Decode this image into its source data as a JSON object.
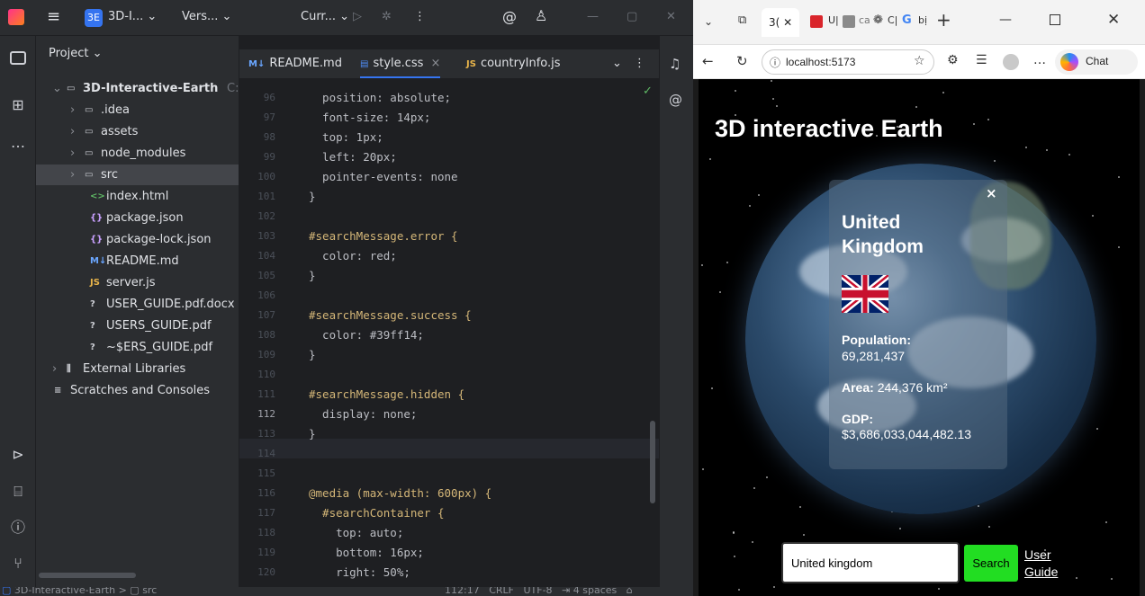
{
  "ide": {
    "toolbar": {
      "project_badge": "3E",
      "project_name": "3D-I...",
      "vcs": "Vers...",
      "run_config": "Curr..."
    },
    "project_panel": {
      "title": "Project",
      "tree": [
        {
          "label": "3D-Interactive-Earth",
          "suffix": "C:\\V",
          "indent": 0,
          "icon": "folder-icon",
          "arrow": "v"
        },
        {
          "label": ".idea",
          "indent": 1,
          "icon": "folder-icon",
          "arrow": ">"
        },
        {
          "label": "assets",
          "indent": 1,
          "icon": "folder-icon",
          "arrow": ">"
        },
        {
          "label": "node_modules",
          "indent": 1,
          "icon": "folder-icon",
          "arrow": ">"
        },
        {
          "label": "src",
          "indent": 1,
          "icon": "folder-icon",
          "arrow": ">",
          "selected": true
        },
        {
          "label": "index.html",
          "indent": 2,
          "icon": "html-icon"
        },
        {
          "label": "package.json",
          "indent": 2,
          "icon": "json-icon"
        },
        {
          "label": "package-lock.json",
          "indent": 2,
          "icon": "json-icon"
        },
        {
          "label": "README.md",
          "indent": 2,
          "icon": "markdown-icon"
        },
        {
          "label": "server.js",
          "indent": 2,
          "icon": "js-icon"
        },
        {
          "label": "USER_GUIDE.pdf.docx",
          "indent": 2,
          "icon": "unknown-file-icon"
        },
        {
          "label": "USERS_GUIDE.pdf",
          "indent": 2,
          "icon": "unknown-file-icon"
        },
        {
          "label": "~$ERS_GUIDE.pdf",
          "indent": 2,
          "icon": "unknown-file-icon"
        },
        {
          "label": "External Libraries",
          "indent": 0,
          "icon": "library-icon",
          "arrow": ">"
        },
        {
          "label": "Scratches and Consoles",
          "indent": 0,
          "icon": "scratches-icon"
        }
      ]
    },
    "tabs": [
      {
        "label": "README.md",
        "icon": "markdown-icon"
      },
      {
        "label": "style.css",
        "icon": "css-icon",
        "active": true,
        "close": "×"
      },
      {
        "label": "countryInfo.js",
        "icon": "js-icon"
      }
    ],
    "code": [
      {
        "n": "96",
        "text": "  position: absolute;"
      },
      {
        "n": "97",
        "text": "  font-size: 14px;"
      },
      {
        "n": "98",
        "text": "  top: 1px;"
      },
      {
        "n": "99",
        "text": "  left: 20px;"
      },
      {
        "n": "100",
        "text": "  pointer-events: none"
      },
      {
        "n": "101",
        "text": "}"
      },
      {
        "n": "102",
        "text": ""
      },
      {
        "n": "103",
        "text": "#searchMessage.error {"
      },
      {
        "n": "104",
        "text": "  color: red;"
      },
      {
        "n": "105",
        "text": "}"
      },
      {
        "n": "106",
        "text": ""
      },
      {
        "n": "107",
        "text": "#searchMessage.success {"
      },
      {
        "n": "108",
        "text": "  color: #39ff14;"
      },
      {
        "n": "109",
        "text": "}"
      },
      {
        "n": "110",
        "text": ""
      },
      {
        "n": "111",
        "text": "#searchMessage.hidden {"
      },
      {
        "n": "112",
        "text": "  display: none;"
      },
      {
        "n": "113",
        "text": "}"
      },
      {
        "n": "114",
        "text": ""
      },
      {
        "n": "115",
        "text": ""
      },
      {
        "n": "116",
        "text": "@media (max-width: 600px) {"
      },
      {
        "n": "117",
        "text": "  #searchContainer {"
      },
      {
        "n": "118",
        "text": "    top: auto;"
      },
      {
        "n": "119",
        "text": "    bottom: 16px;"
      },
      {
        "n": "120",
        "text": "    right: 50%;"
      }
    ],
    "status_bar": {
      "breadcrumb_project": "3D-Interactive-Earth",
      "breadcrumb_folder": "src",
      "position": "112:17",
      "line_sep": "CRLF",
      "encoding": "UTF-8",
      "indent": "4 spaces"
    }
  },
  "browser": {
    "tab_label": "3(",
    "address": "localhost:5173",
    "chat_label": "Chat",
    "page": {
      "heading": "3D interactive Earth",
      "card": {
        "close": "×",
        "country": "United Kingdom",
        "population_label": "Population:",
        "population_value": "69,281,437",
        "area_label": "Area:",
        "area_value": "244,376 km²",
        "gdp_label": "GDP:",
        "gdp_value": "$3,686,033,044,482.13"
      },
      "search_value": "United kingdom",
      "search_button": "Search",
      "guide_link": "User Guide"
    }
  }
}
